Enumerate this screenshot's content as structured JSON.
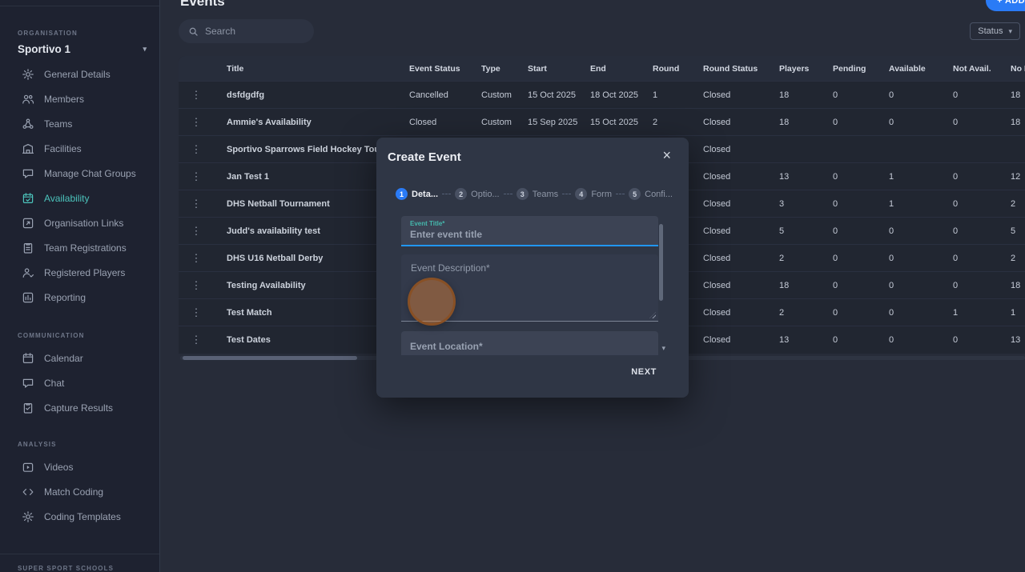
{
  "sidebar": {
    "org_label": "ORGANISATION",
    "org_name": "Sportivo 1",
    "items": [
      "General Details",
      "Members",
      "Teams",
      "Facilities",
      "Manage Chat Groups",
      "Availability",
      "Organisation Links",
      "Team Registrations",
      "Registered Players",
      "Reporting"
    ],
    "communication_label": "COMMUNICATION",
    "communication_items": [
      "Calendar",
      "Chat",
      "Capture Results"
    ],
    "analysis_label": "ANALYSIS",
    "analysis_items": [
      "Videos",
      "Match Coding",
      "Coding Templates"
    ],
    "footer_label": "SUPER SPORT SCHOOLS"
  },
  "header": {
    "title": "Events",
    "add_button": "+ ADD",
    "search_placeholder": "Search",
    "status_filter": "Status",
    "status_chevron": "▾"
  },
  "table": {
    "columns": [
      "Title",
      "Event Status",
      "Type",
      "Start",
      "End",
      "Round",
      "Round Status",
      "Players",
      "Pending",
      "Available",
      "Not Avail.",
      "No R"
    ],
    "rows": [
      [
        "dsfdgdfg",
        "Cancelled",
        "Custom",
        "15 Oct 2025",
        "18 Oct 2025",
        "1",
        "Closed",
        "18",
        "0",
        "0",
        "0",
        "18"
      ],
      [
        "Ammie's Availability",
        "Closed",
        "Custom",
        "15 Sep 2025",
        "15 Oct 2025",
        "2",
        "Closed",
        "18",
        "0",
        "0",
        "0",
        "18"
      ],
      [
        "Sportivo Sparrows Field Hockey Tournam",
        "",
        "",
        "",
        "",
        "",
        "Closed",
        "",
        "",
        "",
        "",
        ""
      ],
      [
        "Jan Test 1",
        "",
        "",
        "",
        "",
        "",
        "Closed",
        "13",
        "0",
        "1",
        "0",
        "12"
      ],
      [
        "DHS Netball Tournament",
        "",
        "",
        "",
        "",
        "",
        "Closed",
        "3",
        "0",
        "1",
        "0",
        "2"
      ],
      [
        "Judd's availability test",
        "",
        "",
        "",
        "",
        "",
        "Closed",
        "5",
        "0",
        "0",
        "0",
        "5"
      ],
      [
        "DHS U16 Netball Derby",
        "",
        "",
        "",
        "",
        "",
        "Closed",
        "2",
        "0",
        "0",
        "0",
        "2"
      ],
      [
        "Testing Availability",
        "",
        "",
        "",
        "",
        "",
        "Closed",
        "18",
        "0",
        "0",
        "0",
        "18"
      ],
      [
        "Test Match",
        "",
        "",
        "",
        "",
        "",
        "Closed",
        "2",
        "0",
        "0",
        "1",
        "1"
      ],
      [
        "Test Dates",
        "",
        "",
        "",
        "",
        "",
        "Closed",
        "13",
        "0",
        "0",
        "0",
        "13"
      ]
    ]
  },
  "modal": {
    "title": "Create Event",
    "close": "×",
    "steps": [
      {
        "num": "1",
        "label": "Deta..."
      },
      {
        "num": "2",
        "label": "Optio..."
      },
      {
        "num": "3",
        "label": "Teams"
      },
      {
        "num": "4",
        "label": "Form"
      },
      {
        "num": "5",
        "label": "Confi..."
      }
    ],
    "fields": {
      "title_label": "Event Title*",
      "title_placeholder": "Enter event title",
      "description_label": "Event Description*",
      "location_label": "Event Location*"
    },
    "scroll_arrow": "▾",
    "next_button": "NEXT"
  },
  "colors": {
    "accent_blue": "#2a7bf6",
    "accent_teal": "#4cc4bc",
    "focus_underline": "#2196f3",
    "highlight_orange": "#d67e38"
  }
}
